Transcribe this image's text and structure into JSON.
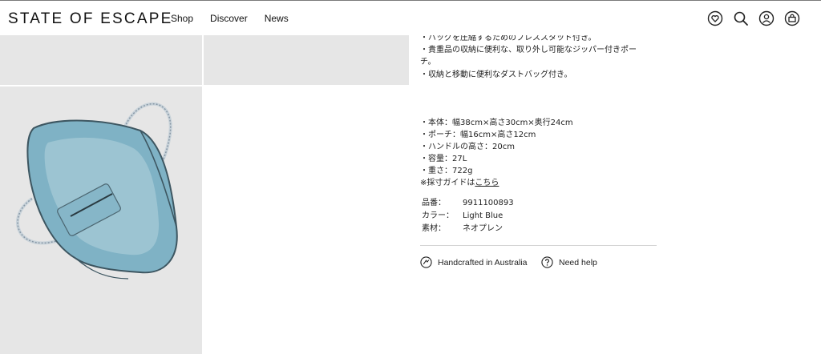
{
  "header": {
    "logo": "STATE OF ESCAPE",
    "nav": [
      "Shop",
      "Discover",
      "News"
    ],
    "icons": [
      "wishlist-heart-icon",
      "search-icon",
      "account-icon",
      "cart-icon"
    ]
  },
  "description": {
    "bullets": [
      "・バッグを圧縮するためのプレススタッド付き。",
      "・貴重品の収納に便利な、取り外し可能なジッパー付きポー",
      "チ。",
      "・収納と移動に便利なダストバッグ付き。"
    ]
  },
  "specs": {
    "lines": [
      "・本体：幅38cm×高さ30cm×奥行24cm",
      "・ポーチ：幅16cm×高さ12cm",
      "・ハンドルの高さ：20cm",
      "・容量：27L",
      "・重さ：722g"
    ],
    "guide_prefix": "※採寸ガイドは",
    "guide_link": "こちら"
  },
  "meta": {
    "rows": [
      {
        "label": "品番：",
        "value": "9911100893"
      },
      {
        "label": "カラー：",
        "value": "Light Blue"
      },
      {
        "label": "素材：",
        "value": "ネオプレン"
      }
    ]
  },
  "features": {
    "handcrafted": "Handcrafted in Australia",
    "help": "Need help"
  },
  "colors": {
    "tile_bg": "#e6e6e6",
    "bag_blue": "#7fb2c5"
  }
}
